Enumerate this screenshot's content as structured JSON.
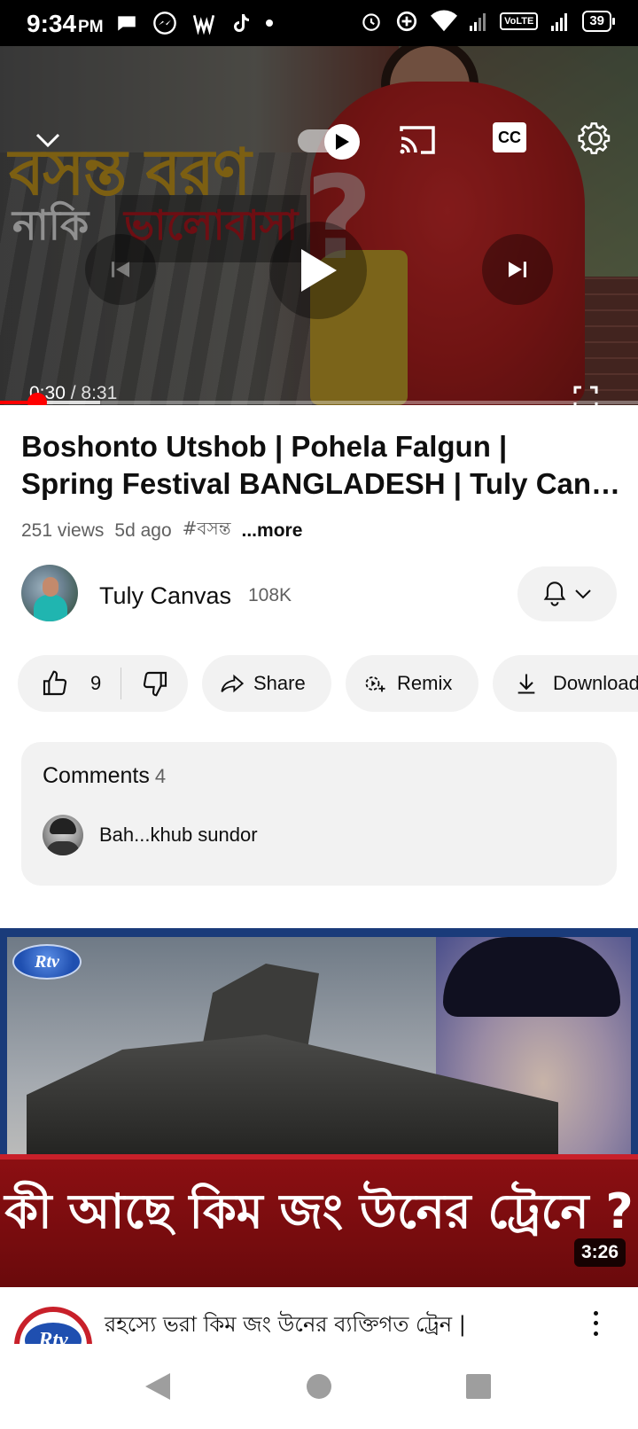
{
  "status_bar": {
    "time": "9:34",
    "ampm": "PM",
    "volte": "VoLTE",
    "battery": "39"
  },
  "player": {
    "overlay_title_line1": "বসন্ত বরণ",
    "overlay_title_line2a": "নাকি",
    "overlay_title_line2b": "ভালোবাসা",
    "overlay_qmark": "?",
    "cc_label": "CC",
    "current_time": "0:30",
    "separator": " / ",
    "duration": "8:31",
    "progress_fraction": 0.059,
    "buffer_fraction": 0.157
  },
  "video": {
    "title_line1": "Boshonto Utshob | Pohela Falgun |",
    "title_line2": "Spring Festival BANGLADESH | Tuly Canvas",
    "views": "251 views",
    "age": "5d ago",
    "hashtag": "#বসন্ত",
    "more": "...more"
  },
  "channel": {
    "name": "Tuly Canvas",
    "subscribers": "108K"
  },
  "actions": {
    "likes": "9",
    "share": "Share",
    "remix": "Remix",
    "download": "Download"
  },
  "comments": {
    "title": "Comments",
    "count": "4",
    "top_comment": "Bah...khub sundor"
  },
  "next_video": {
    "channel_logo": "Rtv",
    "thumb_headline": "কী আছে কিম জং উনের ট্রেনে ?",
    "duration": "3:26",
    "title": "রহস্যে ভরা কিম জং উনের ব্যক্তিগত ট্রেন |"
  }
}
